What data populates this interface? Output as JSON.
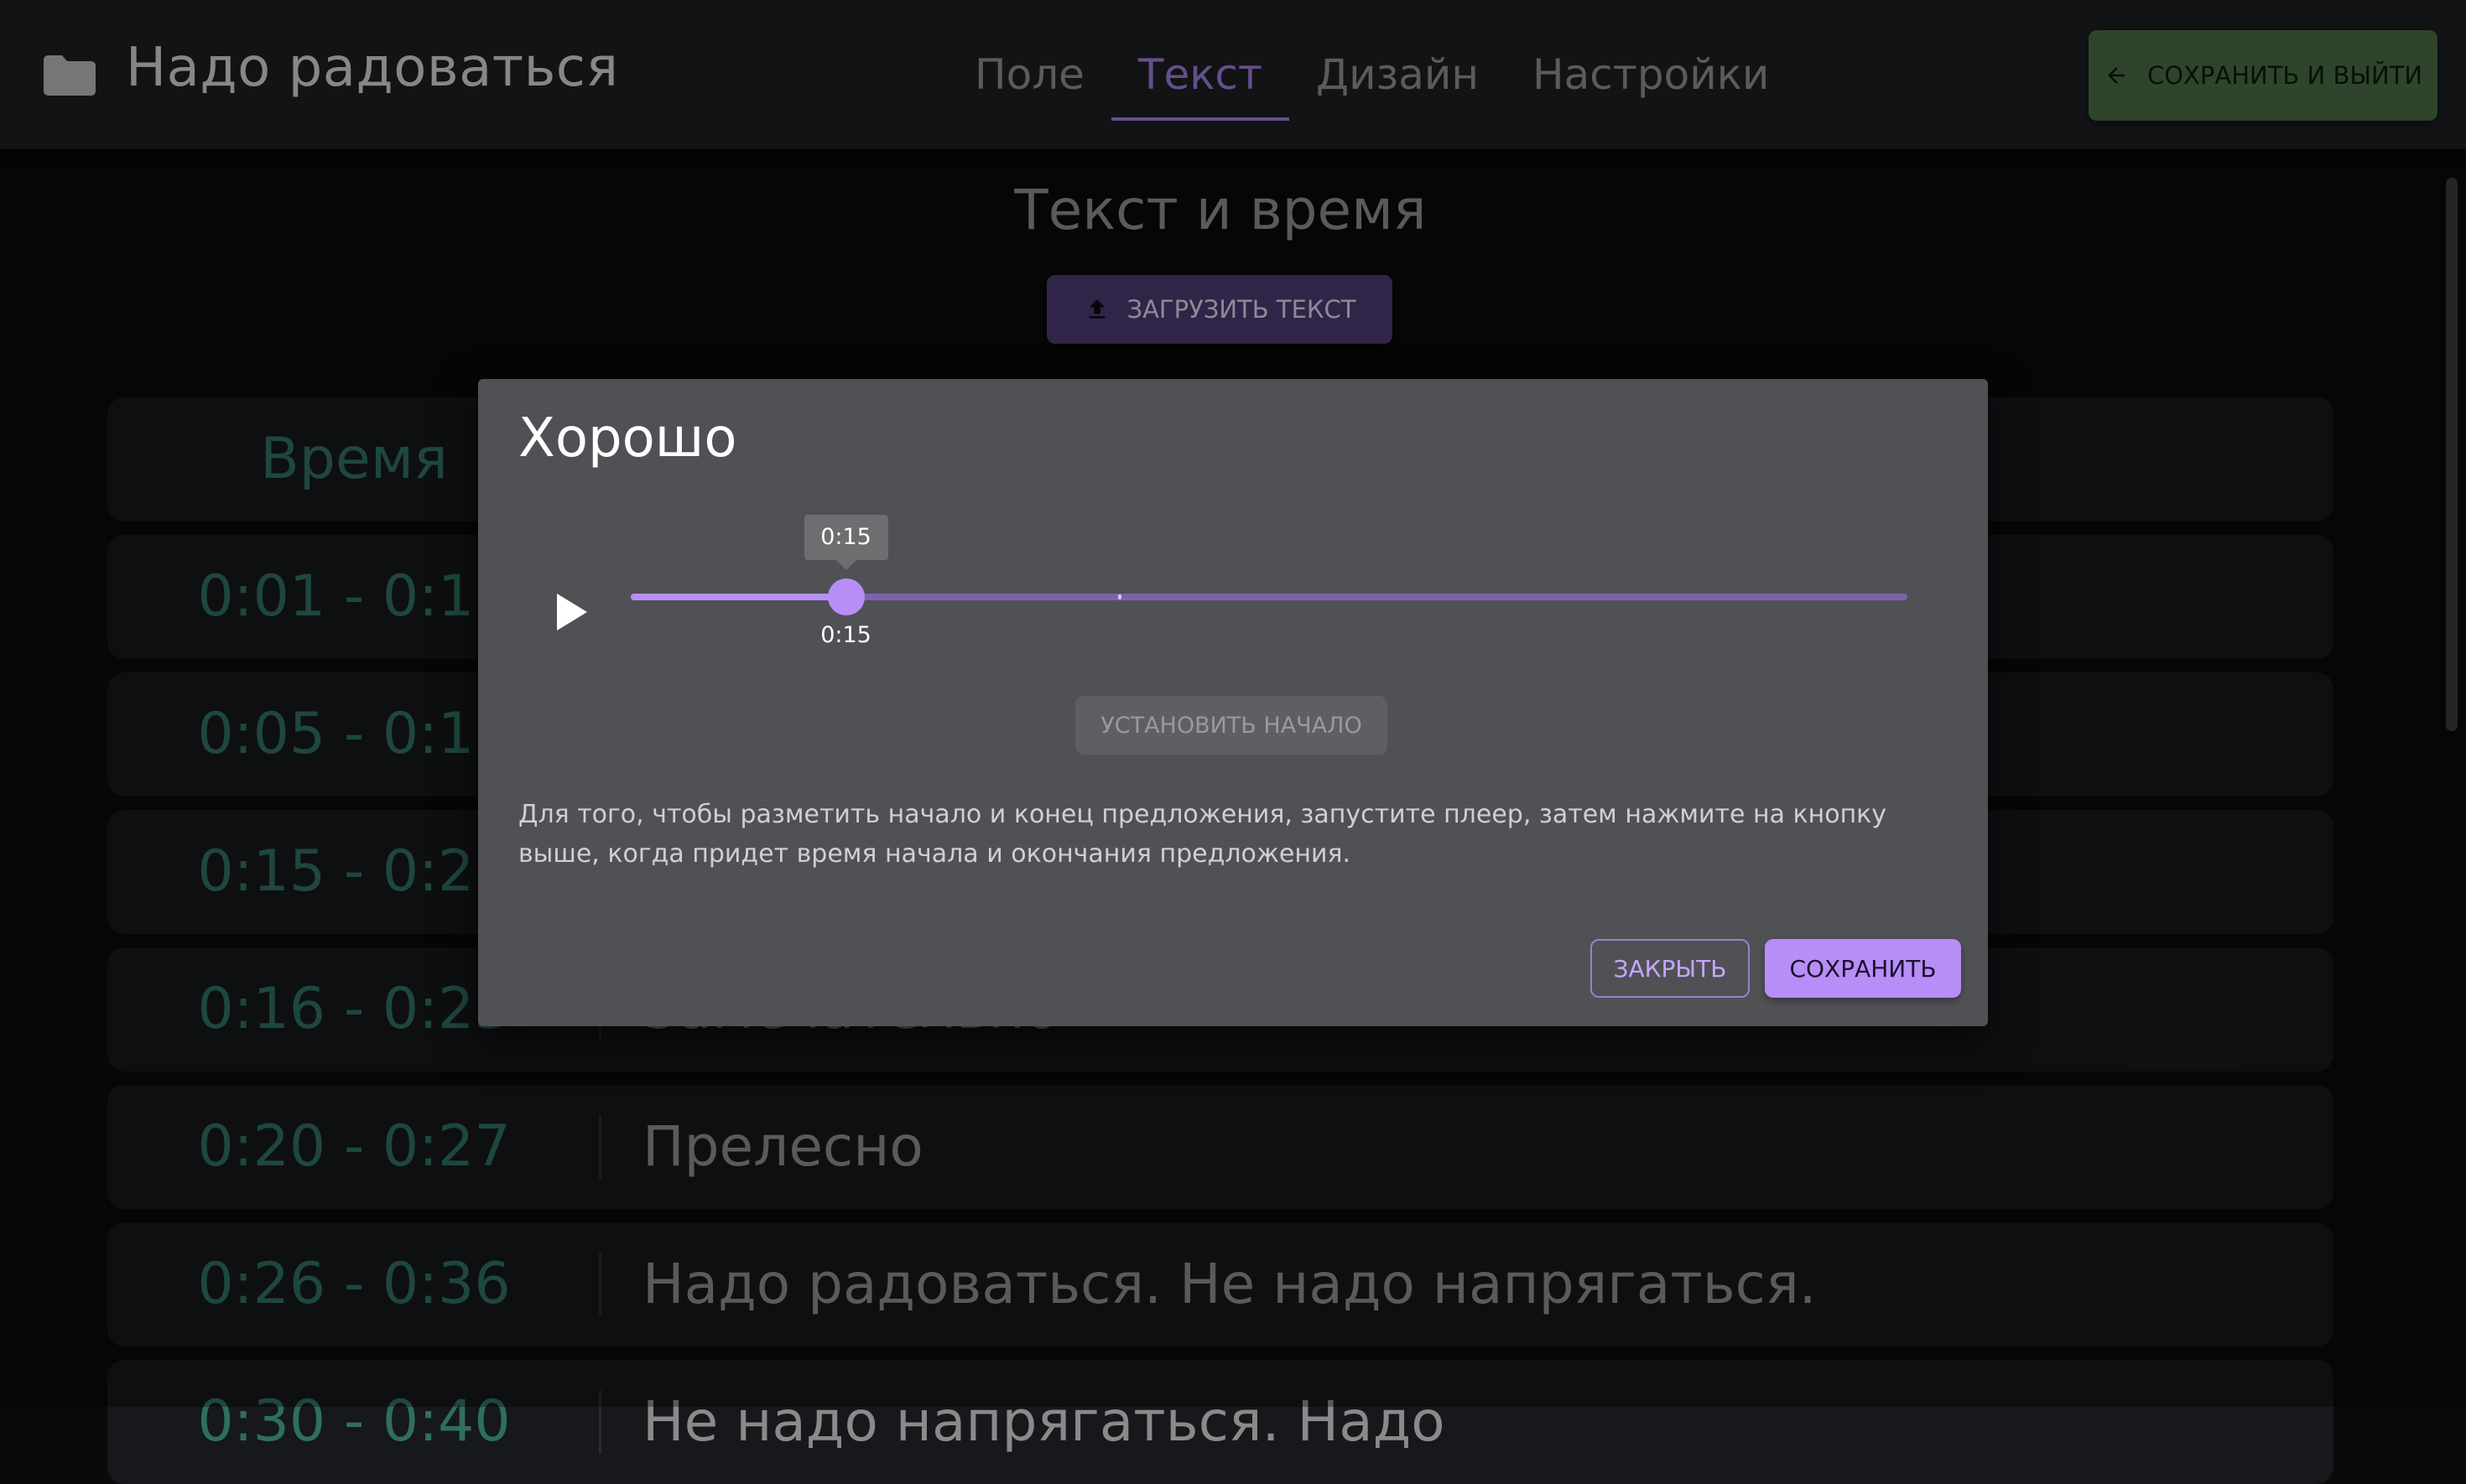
{
  "appbar": {
    "icon": "folder-icon",
    "title": "Надо радоваться",
    "tabs": [
      {
        "label": "Поле",
        "active": false
      },
      {
        "label": "Текст",
        "active": true
      },
      {
        "label": "Дизайн",
        "active": false
      },
      {
        "label": "Настройки",
        "active": false
      }
    ],
    "save_exit_label": "СОХРАНИТЬ И ВЫЙТИ",
    "save_exit_icon": "arrow-left-icon"
  },
  "page": {
    "heading": "Текст и время",
    "upload_label": "ЗАГРУЗИТЬ ТЕКСТ",
    "upload_icon": "upload-icon"
  },
  "table": {
    "header_time": "Время",
    "rows": [
      {
        "time": "0:01 - 0:11",
        "text": ""
      },
      {
        "time": "0:05 - 0:16",
        "text": ""
      },
      {
        "time": "0:15 - 0:21",
        "text": ""
      },
      {
        "time": "0:16 - 0:23",
        "text": "Замечательно"
      },
      {
        "time": "0:20 - 0:27",
        "text": "Прелесно"
      },
      {
        "time": "0:26 - 0:36",
        "text": "Надо радоваться. Не надо напрягаться."
      },
      {
        "time": "0:30 - 0:40",
        "text": "Не надо напрягаться. Надо"
      }
    ]
  },
  "dialog": {
    "title": "Хорошо",
    "play_icon": "play-icon",
    "slider": {
      "value": 15,
      "max": 89,
      "buffered": 34,
      "tooltip": "0:15",
      "value_label": "0:15"
    },
    "set_start_label": "УСТАНОВИТЬ НАЧАЛО",
    "instructions": "Для того, чтобы разметить начало и конец предложения, запустите плеер, затем нажмите на кнопку выше, когда придет время начала и окончания предложения.",
    "close_label": "ЗАКРЫТЬ",
    "save_label": "СОХРАНИТЬ"
  },
  "colors": {
    "accent": "#b78ef7",
    "tab_active": "#9b7ad6",
    "time_text": "#2f6e5e",
    "save_exit_bg": "#486b42",
    "dialog_bg": "#505155"
  }
}
